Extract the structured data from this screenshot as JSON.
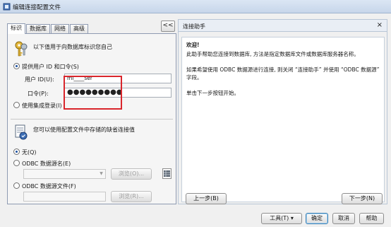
{
  "window": {
    "title": "编辑连接配置文件"
  },
  "tabs": [
    {
      "label": "标识",
      "active": true
    },
    {
      "label": "数据库",
      "active": false
    },
    {
      "label": "网络",
      "active": false
    },
    {
      "label": "高级",
      "active": false
    }
  ],
  "collapse_label": "<<",
  "identity": {
    "prompt": "以下值用于向数据库标识您自己",
    "provide_user_label": "提供用户 ID 和口令(S)",
    "user_id_label": "用户 ID(U):",
    "user_id_value": "ml____ser",
    "password_label": "口令(P):",
    "password_value": "●●●●●●●●●",
    "integrated_login_label": "使用集成登录(I)"
  },
  "defaults": {
    "prompt": "您可以使用配置文件中存储的缺省连接值",
    "none_label": "无(Q)",
    "odbc_source_label": "ODBC 数据源名(E)",
    "odbc_file_label": "ODBC 数据源文件(F)",
    "browse_label": "浏览(O)...",
    "browse_label_2": "浏览(R)..."
  },
  "assistant": {
    "header": "连接助手",
    "close": "×",
    "welcome": "欢迎!",
    "p1": "此助手帮助您连接到数据库, 方法是指定数据库文件或数据库服务器名称。",
    "p2": "如果希望使用 ODBC 数据源进行连接, 则关闭 “连接助手” 并使用 “ODBC 数据源” 字段。",
    "p3": "单击下一步按钮开始。",
    "back_label": "上一步(B)",
    "next_label": "下一步(N)"
  },
  "footer": {
    "tools_label": "工具(T)",
    "ok_label": "确定",
    "cancel_label": "取消",
    "help_label": "帮助"
  }
}
